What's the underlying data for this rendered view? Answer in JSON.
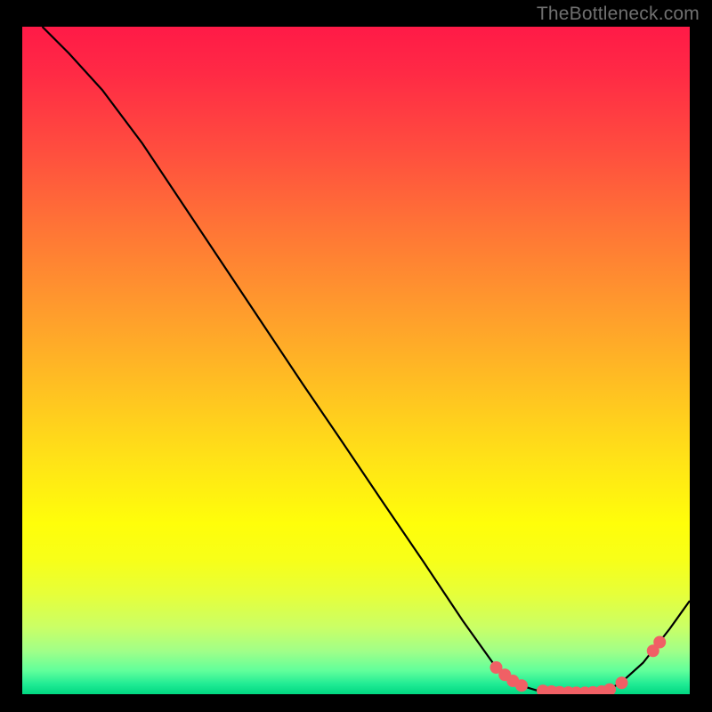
{
  "attribution": "TheBottleneck.com",
  "chart_data": {
    "type": "line",
    "title": "",
    "xlabel": "",
    "ylabel": "",
    "xlim": [
      0,
      100
    ],
    "ylim": [
      0,
      100
    ],
    "grid": false,
    "legend": false,
    "background": "gradient-red-green",
    "series": [
      {
        "name": "curve",
        "x": [
          3,
          7,
          12,
          18,
          24,
          30,
          36,
          42,
          48,
          54,
          60,
          66,
          71,
          74,
          77,
          80,
          82,
          84,
          86,
          88,
          90,
          93,
          97,
          100
        ],
        "y": [
          100,
          96,
          90.5,
          82.5,
          73.5,
          64.5,
          55.5,
          46.5,
          37.7,
          28.8,
          20,
          11,
          4,
          1.5,
          0.6,
          0.3,
          0.2,
          0.2,
          0.3,
          0.7,
          2,
          4.7,
          9.8,
          14
        ]
      }
    ],
    "markers": [
      {
        "x": 71.0,
        "y": 4.0
      },
      {
        "x": 72.3,
        "y": 2.9
      },
      {
        "x": 73.5,
        "y": 2.0
      },
      {
        "x": 74.8,
        "y": 1.3
      },
      {
        "x": 78.0,
        "y": 0.5
      },
      {
        "x": 79.3,
        "y": 0.4
      },
      {
        "x": 80.5,
        "y": 0.3
      },
      {
        "x": 81.8,
        "y": 0.25
      },
      {
        "x": 83.0,
        "y": 0.22
      },
      {
        "x": 84.3,
        "y": 0.22
      },
      {
        "x": 85.5,
        "y": 0.28
      },
      {
        "x": 86.8,
        "y": 0.4
      },
      {
        "x": 88.0,
        "y": 0.7
      },
      {
        "x": 89.8,
        "y": 1.7
      },
      {
        "x": 94.5,
        "y": 6.5
      },
      {
        "x": 95.5,
        "y": 7.8
      }
    ],
    "gradient_stops": [
      {
        "offset": 0.0,
        "color": "#ff1a47"
      },
      {
        "offset": 0.07,
        "color": "#ff2a45"
      },
      {
        "offset": 0.18,
        "color": "#ff4c3f"
      },
      {
        "offset": 0.3,
        "color": "#ff7436"
      },
      {
        "offset": 0.42,
        "color": "#ff9a2d"
      },
      {
        "offset": 0.54,
        "color": "#ffc022"
      },
      {
        "offset": 0.65,
        "color": "#ffe317"
      },
      {
        "offset": 0.745,
        "color": "#fffe0a"
      },
      {
        "offset": 0.8,
        "color": "#f7ff19"
      },
      {
        "offset": 0.85,
        "color": "#e6ff3a"
      },
      {
        "offset": 0.9,
        "color": "#caff66"
      },
      {
        "offset": 0.935,
        "color": "#a1ff88"
      },
      {
        "offset": 0.965,
        "color": "#60ff9b"
      },
      {
        "offset": 0.985,
        "color": "#20eb94"
      },
      {
        "offset": 1.0,
        "color": "#00d781"
      }
    ],
    "marker_color": "#f06065",
    "line_color": "#000000"
  }
}
